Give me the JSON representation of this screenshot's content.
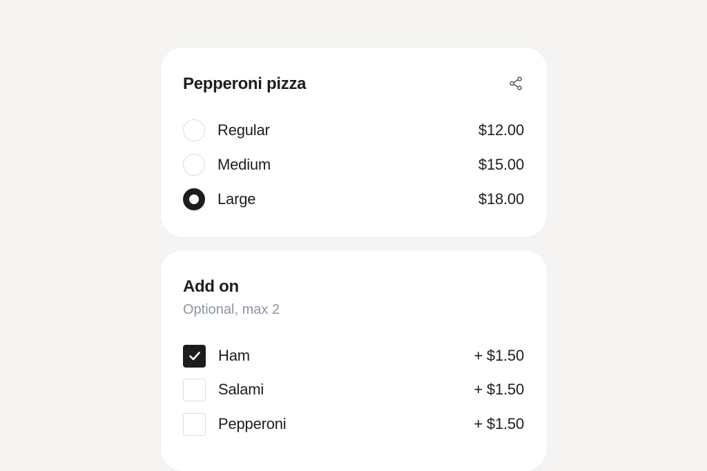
{
  "size_card": {
    "title": "Pepperoni pizza",
    "share_icon": "share-icon",
    "options": [
      {
        "label": "Regular",
        "price": "$12.00",
        "selected": false
      },
      {
        "label": "Medium",
        "price": "$15.00",
        "selected": false
      },
      {
        "label": "Large",
        "price": "$18.00",
        "selected": true
      }
    ]
  },
  "addon_card": {
    "title": "Add on",
    "subtitle": "Optional, max 2",
    "items": [
      {
        "label": "Ham",
        "price": "+ $1.50",
        "checked": true
      },
      {
        "label": "Salami",
        "price": "+ $1.50",
        "checked": false
      },
      {
        "label": "Pepperoni",
        "price": "+ $1.50",
        "checked": false
      }
    ]
  },
  "colors": {
    "background": "#f5f4f2",
    "card": "#ffffff",
    "accent": "#1c1d1f",
    "muted_text": "#8a94a0",
    "border": "#dcdcdc"
  }
}
